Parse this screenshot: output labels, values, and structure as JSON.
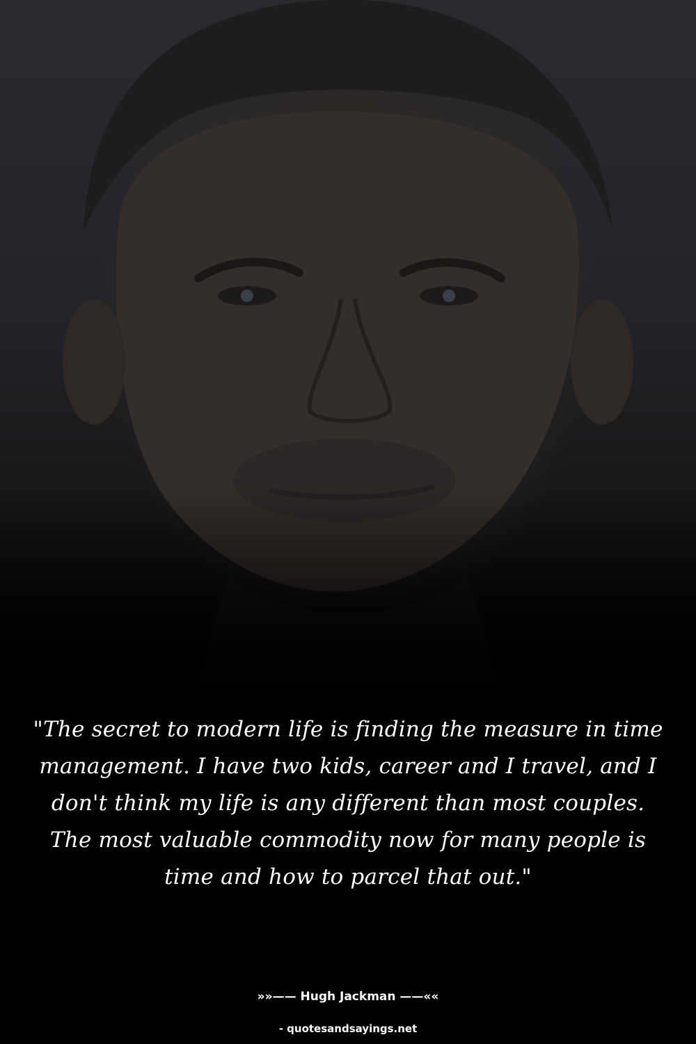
{
  "photo": {
    "subject_icon": "portrait-photo"
  },
  "quote": {
    "text": "\"The secret to modern life is finding the measure in time management. I have two kids, career and I travel, and I don't think my life is any different than most couples. The most valuable commodity now for many people is time and how to parcel that out.\""
  },
  "author": {
    "line": "»»—— Hugh Jackman ——««"
  },
  "source": {
    "text": "- quotesandsayings.net"
  },
  "colors": {
    "background": "#000000",
    "text": "#ffffff"
  }
}
